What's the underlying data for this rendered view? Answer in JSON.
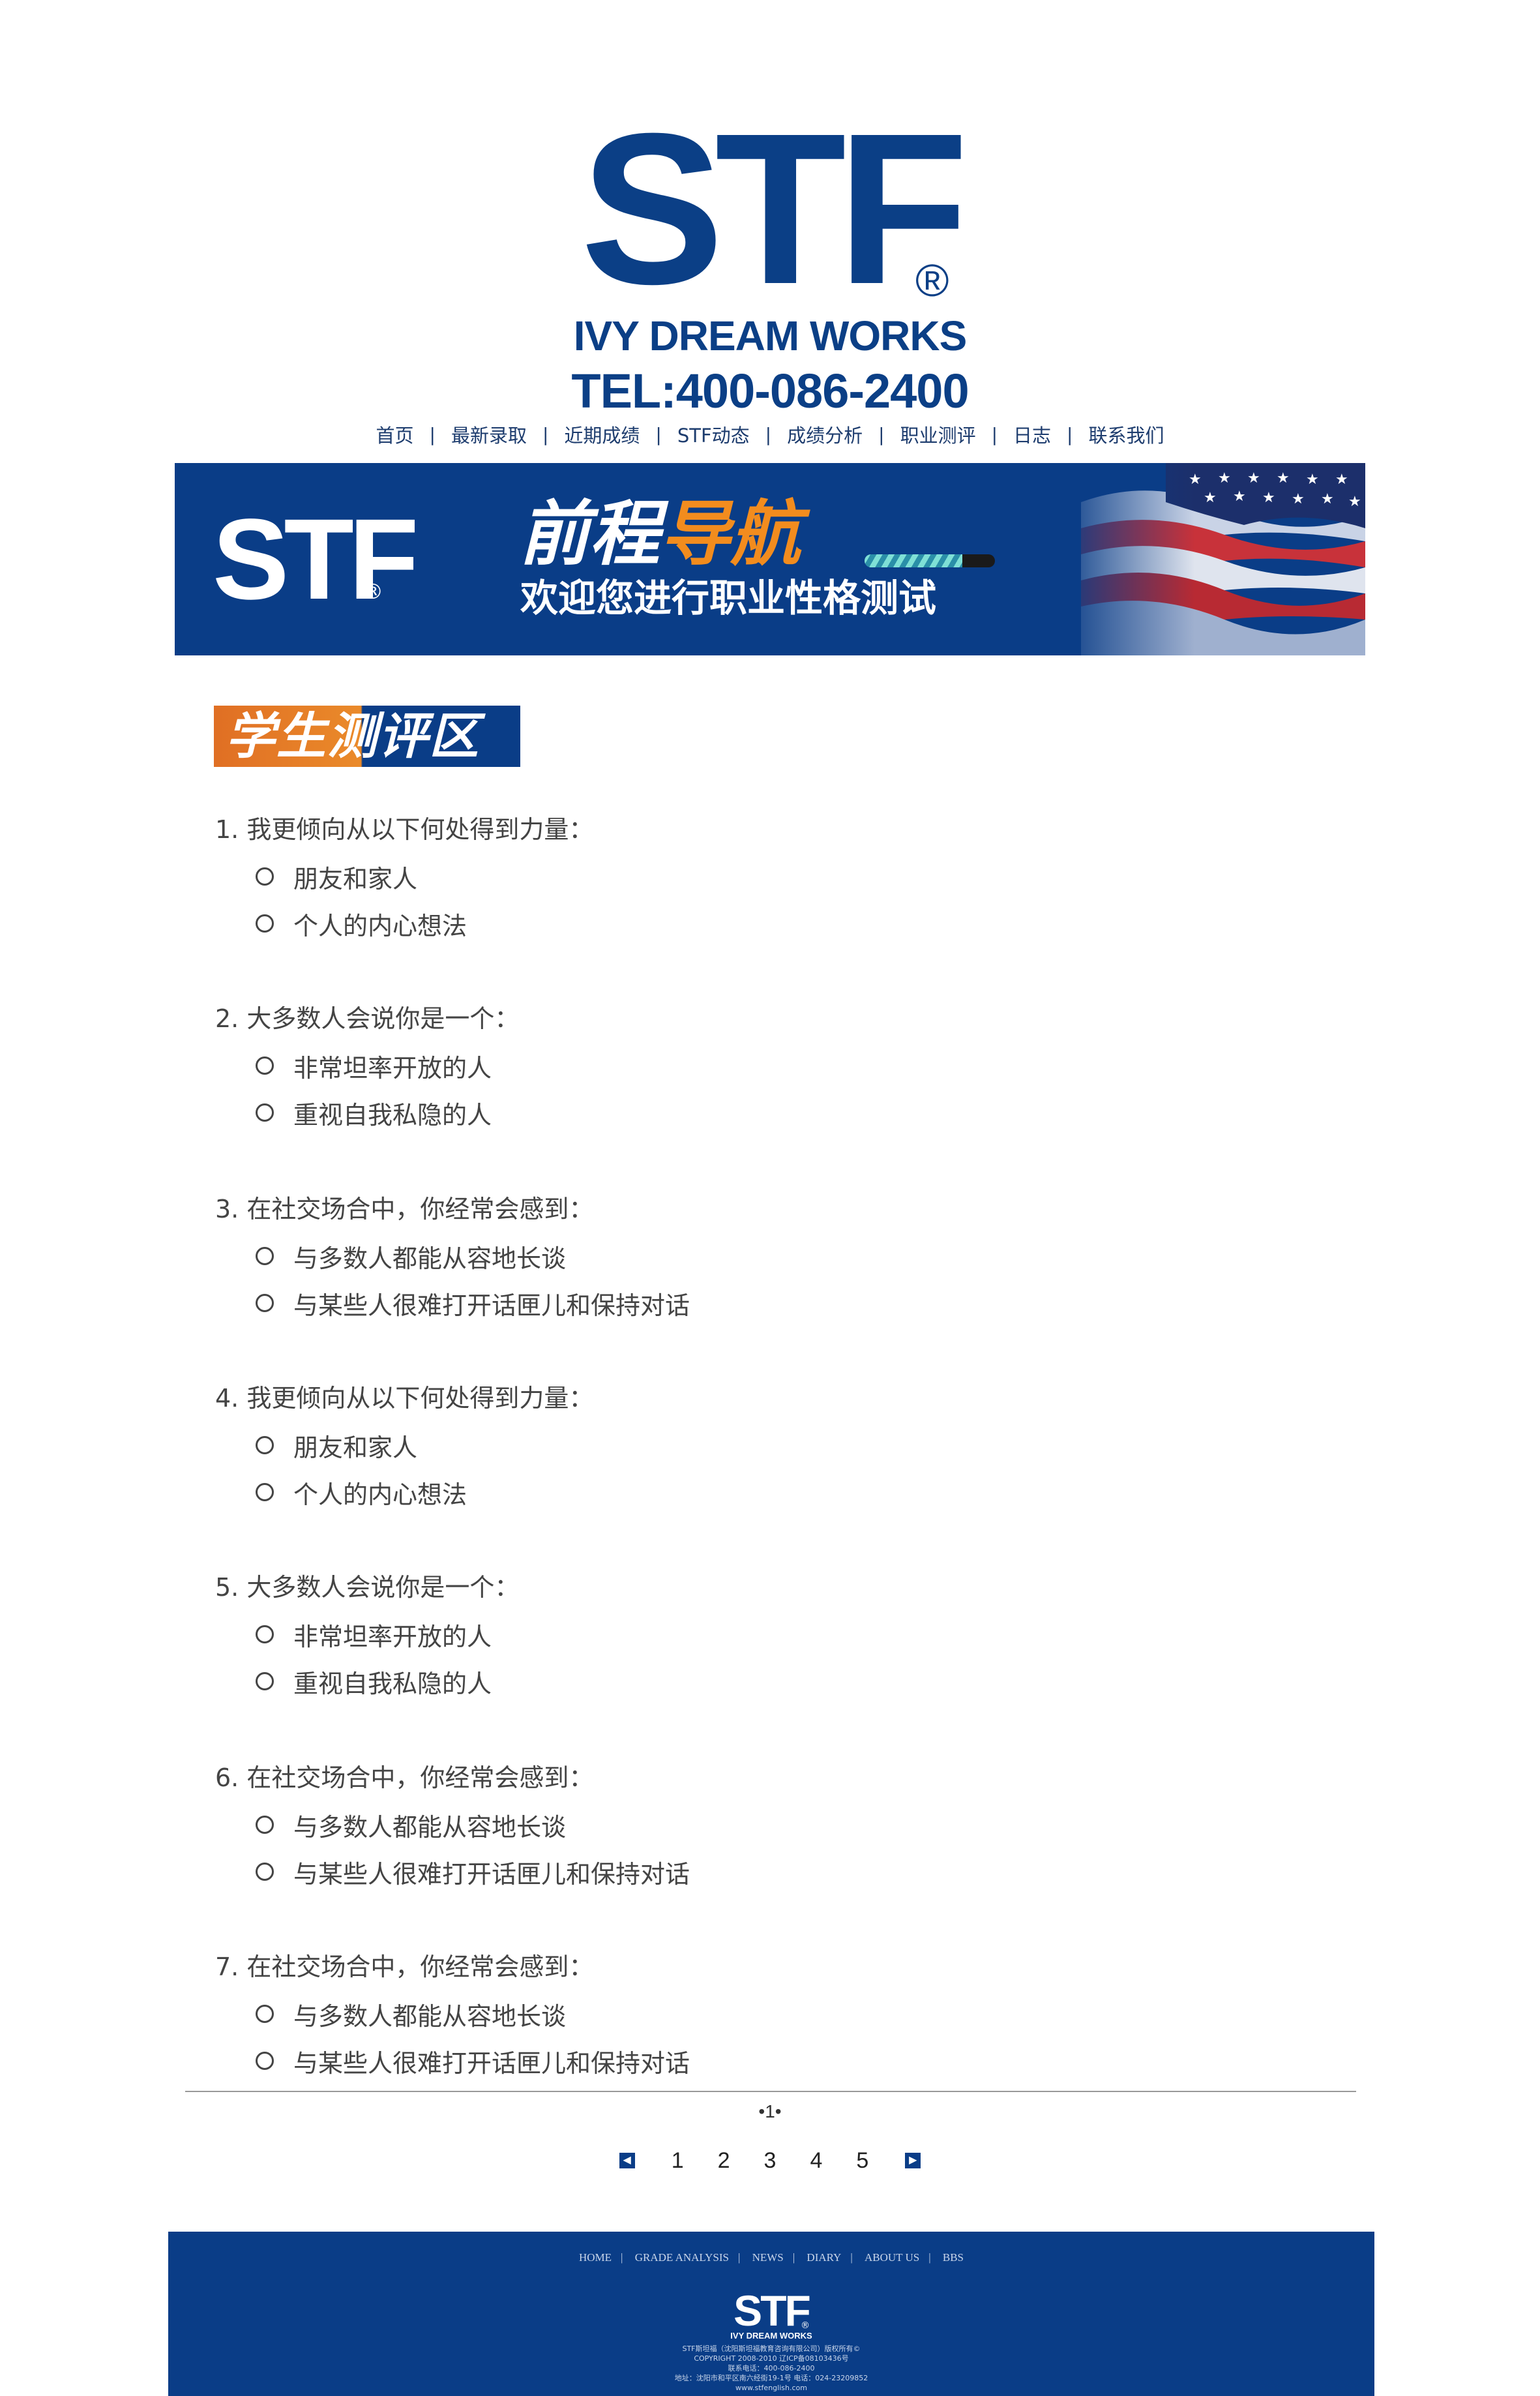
{
  "header": {
    "logo": "STF",
    "reg_mark": "®",
    "subtitle": "IVY DREAM WORKS",
    "tel": "TEL:400-086-2400"
  },
  "nav": {
    "items": [
      "首页",
      "最新录取",
      "近期成绩",
      "STF动态",
      "成绩分析",
      "职业测评",
      "日志",
      "联系我们"
    ],
    "separator": "|"
  },
  "banner": {
    "logo": "STF",
    "reg_mark": "®",
    "title_part1": "前程",
    "title_highlight": "导航",
    "subtitle": "欢迎您进行职业性格测试"
  },
  "section": {
    "title": "学生测评区"
  },
  "questions": [
    {
      "text": "1. 我更倾向从以下何处得到力量：",
      "options": [
        "朋友和家人",
        "个人的内心想法"
      ]
    },
    {
      "text": "2. 大多数人会说你是一个：",
      "options": [
        "非常坦率开放的人",
        "重视自我私隐的人"
      ]
    },
    {
      "text": "3. 在社交场合中，你经常会感到：",
      "options": [
        "与多数人都能从容地长谈",
        "与某些人很难打开话匣儿和保持对话"
      ]
    },
    {
      "text": "4. 我更倾向从以下何处得到力量：",
      "options": [
        "朋友和家人",
        "个人的内心想法"
      ]
    },
    {
      "text": "5. 大多数人会说你是一个：",
      "options": [
        "非常坦率开放的人",
        "重视自我私隐的人"
      ]
    },
    {
      "text": "6. 在社交场合中，你经常会感到：",
      "options": [
        "与多数人都能从容地长谈",
        "与某些人很难打开话匣儿和保持对话"
      ]
    },
    {
      "text": "7. 在社交场合中，你经常会感到：",
      "options": [
        "与多数人都能从容地长谈",
        "与某些人很难打开话匣儿和保持对话"
      ]
    }
  ],
  "page_number": "•1•",
  "pagination": {
    "pages": [
      "1",
      "2",
      "3",
      "4",
      "5"
    ],
    "prev_icon": "◀",
    "next_icon": "▶"
  },
  "footer": {
    "nav": [
      "HOME",
      "GRADE ANALYSIS",
      "NEWS",
      "DIARY",
      "ABOUT US",
      "BBS"
    ],
    "separator": "|",
    "logo": "STF",
    "reg_mark": "®",
    "subtitle": "IVY DREAM WORKS",
    "lines": [
      "STF斯坦福（沈阳斯坦福教育咨询有限公司）版权所有©",
      "COPYRIGHT 2008-2010   辽ICP备08103436号",
      "联系电话：400-086-2400",
      "地址：沈阳市和平区南六经街19-1号   电话：024-23209852",
      "www.stfenglish.com"
    ]
  },
  "colors": {
    "brand_blue": "#0b3f86",
    "accent_orange": "#f28c1e"
  }
}
